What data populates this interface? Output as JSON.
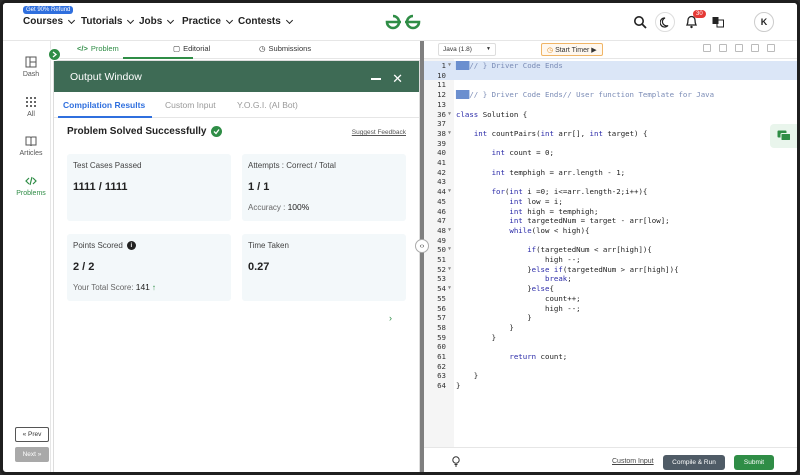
{
  "topnav": {
    "refund_badge": "Get 90% Refund",
    "items": [
      "Courses",
      "Tutorials",
      "Jobs",
      "Practice",
      "Contests"
    ],
    "notification_count": "30",
    "avatar_initial": "K",
    "logo_name": "gfg-logo"
  },
  "sidebar": {
    "items": [
      {
        "label": "Dash",
        "icon": "dashboard-icon"
      },
      {
        "label": "All",
        "icon": "grid-icon"
      },
      {
        "label": "Articles",
        "icon": "book-icon"
      },
      {
        "label": "Problems",
        "icon": "code-icon"
      }
    ],
    "prev_label": "« Prev",
    "next_label": "Next »"
  },
  "problem_tabs": {
    "problem": "Problem",
    "editorial": "Editorial",
    "submissions": "Submissions"
  },
  "output": {
    "title": "Output Window",
    "tabs": [
      "Compilation Results",
      "Custom Input",
      "Y.O.G.I. (AI Bot)"
    ],
    "status": "Problem Solved Successfully",
    "feedback": "Suggest Feedback",
    "cards": {
      "tests_label": "Test Cases Passed",
      "tests_value": "1111 / 1111",
      "attempts_label": "Attempts : Correct / Total",
      "attempts_value": "1 / 1",
      "accuracy_label": "Accuracy :",
      "accuracy_value": "100%",
      "points_label": "Points Scored",
      "points_value": "2 / 2",
      "total_label": "Your Total Score:",
      "total_value": "141",
      "time_label": "Time Taken",
      "time_value": "0.27"
    }
  },
  "editor": {
    "language": "Java (1.8)",
    "timer": "Start Timer",
    "custom_input": "Custom Input",
    "compile": "Compile & Run",
    "submit": "Submit",
    "lines": [
      {
        "n": "1",
        "t": "// } Driver Code Ends",
        "hl": true,
        "sel": true,
        "fold": true
      },
      {
        "n": "10",
        "t": "",
        "hl": true
      },
      {
        "n": "11",
        "t": ""
      },
      {
        "n": "12",
        "t": "// } Driver Code Ends// User function Template for Java",
        "sel": true
      },
      {
        "n": "13",
        "t": ""
      },
      {
        "n": "36",
        "t": "class Solution {",
        "fold": true
      },
      {
        "n": "37",
        "t": ""
      },
      {
        "n": "38",
        "t": "    int countPairs(int arr[], int target) {",
        "fold": true
      },
      {
        "n": "39",
        "t": ""
      },
      {
        "n": "40",
        "t": "        int count = 0;"
      },
      {
        "n": "41",
        "t": ""
      },
      {
        "n": "42",
        "t": "        int temphigh = arr.length - 1;"
      },
      {
        "n": "43",
        "t": ""
      },
      {
        "n": "44",
        "t": "        for(int i =0; i<=arr.length-2;i++){",
        "fold": true
      },
      {
        "n": "45",
        "t": "            int low = i;"
      },
      {
        "n": "46",
        "t": "            int high = temphigh;"
      },
      {
        "n": "47",
        "t": "            int targetedNum = target - arr[low];"
      },
      {
        "n": "48",
        "t": "            while(low < high){",
        "fold": true
      },
      {
        "n": "49",
        "t": ""
      },
      {
        "n": "50",
        "t": "                if(targetedNum < arr[high]){",
        "fold": true
      },
      {
        "n": "51",
        "t": "                    high --;"
      },
      {
        "n": "52",
        "t": "                }else if(targetedNum > arr[high]){",
        "fold": true
      },
      {
        "n": "53",
        "t": "                    break;"
      },
      {
        "n": "54",
        "t": "                }else{",
        "fold": true
      },
      {
        "n": "55",
        "t": "                    count++;"
      },
      {
        "n": "56",
        "t": "                    high --;"
      },
      {
        "n": "57",
        "t": "                }"
      },
      {
        "n": "58",
        "t": "            }"
      },
      {
        "n": "59",
        "t": "        }"
      },
      {
        "n": "60",
        "t": ""
      },
      {
        "n": "61",
        "t": "            return count;"
      },
      {
        "n": "62",
        "t": ""
      },
      {
        "n": "63",
        "t": "    }"
      },
      {
        "n": "64",
        "t": "}"
      }
    ]
  },
  "colors": {
    "brand_green": "#2f8d46",
    "output_header": "#3e6b55",
    "link_blue": "#2f6fde"
  }
}
